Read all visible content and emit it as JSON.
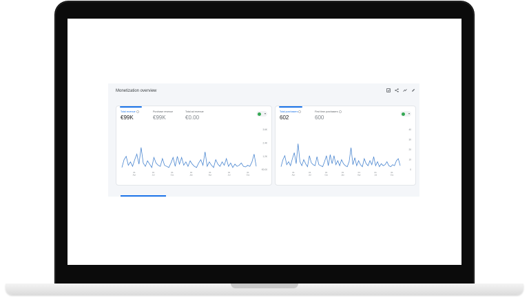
{
  "card": {
    "title": "Monetization overview",
    "toolbar_icons": [
      "compare-icon",
      "share-icon",
      "insights-icon",
      "edit-icon"
    ]
  },
  "left_panel": {
    "metrics": [
      {
        "label": "Total revenue",
        "value": "€99K",
        "active": true
      },
      {
        "label": "Purchase revenue",
        "value": "€99K",
        "active": false
      },
      {
        "label": "Total ad revenue",
        "value": "€0.00",
        "active": false
      }
    ],
    "y_ticks": [
      "3.6K",
      "2.4K",
      "1.2K",
      "€0.00"
    ],
    "x_ticks": [
      "01 Apr",
      "01 Jul",
      "01 Oct",
      "01 Jan",
      "01 Apr",
      "01 Jul",
      "01 Oct"
    ]
  },
  "right_panel": {
    "metrics": [
      {
        "label": "Total purchasers",
        "value": "602",
        "active": true
      },
      {
        "label": "First time purchasers",
        "value": "600",
        "active": false
      }
    ],
    "y_ticks": [
      "40",
      "30",
      "20",
      "10",
      "0"
    ],
    "x_ticks": [
      "01 Apr",
      "01 Jul",
      "01 Oct",
      "01 Jan",
      "01 Apr",
      "01 Jul",
      "01 Oct"
    ]
  },
  "colors": {
    "accent": "#1a73e8",
    "line": "#4a86d0",
    "status_green": "#34a853"
  },
  "chart_data": [
    {
      "type": "line",
      "title": "",
      "xlabel": "",
      "ylabel": "",
      "ylim": [
        0,
        3600
      ],
      "series": [
        {
          "values": [
            200,
            900,
            1200,
            400,
            700,
            300,
            900,
            1400,
            500,
            2000,
            600,
            300,
            800,
            500,
            200,
            1100,
            600,
            400,
            300,
            1000,
            400,
            300,
            200,
            600,
            1100,
            300,
            1200,
            500,
            1100,
            400,
            700,
            300,
            800,
            500,
            300,
            200,
            600,
            900,
            400,
            1600,
            300,
            700,
            400,
            200,
            900,
            500,
            300,
            700,
            400,
            1000,
            300,
            600,
            200,
            500,
            300,
            400,
            600,
            300,
            250,
            400,
            300,
            700,
            1400,
            300
          ]
        }
      ]
    },
    {
      "type": "line",
      "title": "",
      "xlabel": "",
      "ylabel": "",
      "ylim": [
        0,
        40
      ],
      "series": [
        {
          "values": [
            3,
            10,
            14,
            5,
            8,
            4,
            11,
            17,
            6,
            26,
            8,
            4,
            10,
            6,
            3,
            14,
            7,
            5,
            4,
            13,
            5,
            4,
            3,
            8,
            14,
            4,
            15,
            6,
            14,
            5,
            9,
            4,
            10,
            6,
            4,
            3,
            8,
            22,
            5,
            12,
            4,
            9,
            5,
            3,
            11,
            6,
            4,
            9,
            5,
            13,
            4,
            8,
            3,
            6,
            4,
            5,
            8,
            4,
            3,
            5,
            4,
            9,
            11,
            4
          ]
        }
      ]
    }
  ]
}
